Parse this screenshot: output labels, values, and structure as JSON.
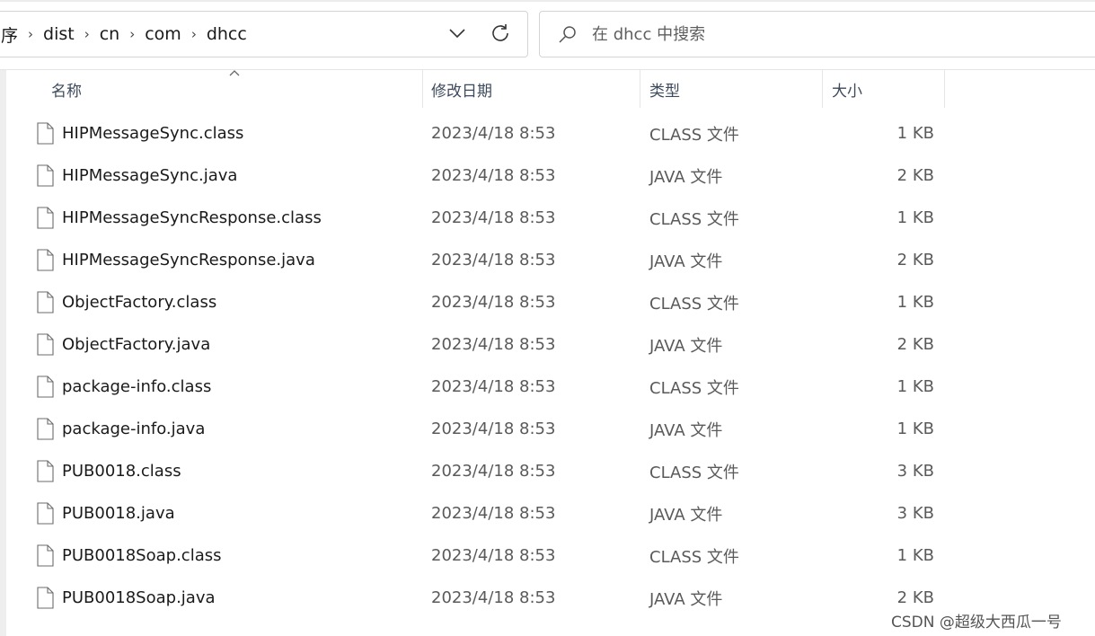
{
  "address": {
    "crumbs": [
      "序",
      "dist",
      "cn",
      "com",
      "dhcc"
    ]
  },
  "search": {
    "placeholder": "在 dhcc 中搜索"
  },
  "columns": {
    "name": "名称",
    "date": "修改日期",
    "type": "类型",
    "size": "大小"
  },
  "files": [
    {
      "name": "HIPMessageSync.class",
      "date": "2023/4/18 8:53",
      "type": "CLASS 文件",
      "size": "1 KB"
    },
    {
      "name": "HIPMessageSync.java",
      "date": "2023/4/18 8:53",
      "type": "JAVA 文件",
      "size": "2 KB"
    },
    {
      "name": "HIPMessageSyncResponse.class",
      "date": "2023/4/18 8:53",
      "type": "CLASS 文件",
      "size": "1 KB"
    },
    {
      "name": "HIPMessageSyncResponse.java",
      "date": "2023/4/18 8:53",
      "type": "JAVA 文件",
      "size": "2 KB"
    },
    {
      "name": "ObjectFactory.class",
      "date": "2023/4/18 8:53",
      "type": "CLASS 文件",
      "size": "1 KB"
    },
    {
      "name": "ObjectFactory.java",
      "date": "2023/4/18 8:53",
      "type": "JAVA 文件",
      "size": "2 KB"
    },
    {
      "name": "package-info.class",
      "date": "2023/4/18 8:53",
      "type": "CLASS 文件",
      "size": "1 KB"
    },
    {
      "name": "package-info.java",
      "date": "2023/4/18 8:53",
      "type": "JAVA 文件",
      "size": "1 KB"
    },
    {
      "name": "PUB0018.class",
      "date": "2023/4/18 8:53",
      "type": "CLASS 文件",
      "size": "3 KB"
    },
    {
      "name": "PUB0018.java",
      "date": "2023/4/18 8:53",
      "type": "JAVA 文件",
      "size": "3 KB"
    },
    {
      "name": "PUB0018Soap.class",
      "date": "2023/4/18 8:53",
      "type": "CLASS 文件",
      "size": "1 KB"
    },
    {
      "name": "PUB0018Soap.java",
      "date": "2023/4/18 8:53",
      "type": "JAVA 文件",
      "size": "2 KB"
    }
  ],
  "watermark": "CSDN @超级大西瓜一号",
  "icons": {
    "file": "file-icon",
    "search": "search-icon",
    "refresh": "refresh-icon",
    "dropdown": "chevron-down-icon",
    "sort": "sort-caret-icon",
    "separator": "chevron-right-icon"
  }
}
